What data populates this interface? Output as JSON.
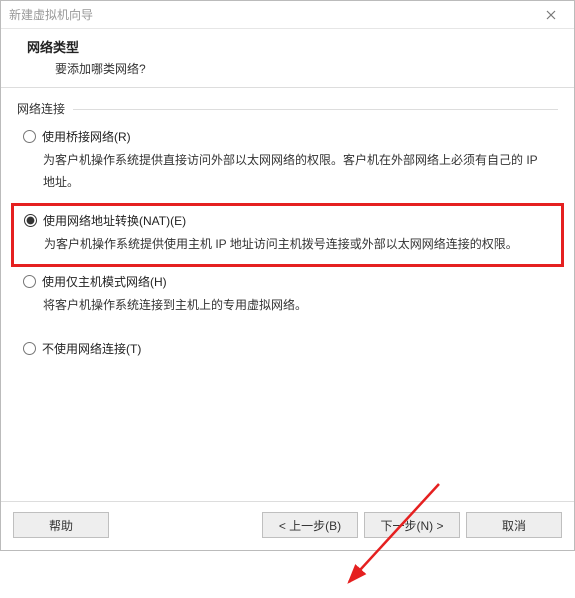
{
  "window": {
    "title": "新建虚拟机向导"
  },
  "header": {
    "title": "网络类型",
    "subtitle": "要添加哪类网络?"
  },
  "group": {
    "label": "网络连接"
  },
  "options": {
    "bridged": {
      "label": "使用桥接网络(R)",
      "desc": "为客户机操作系统提供直接访问外部以太网网络的权限。客户机在外部网络上必须有自己的 IP 地址。"
    },
    "nat": {
      "label": "使用网络地址转换(NAT)(E)",
      "desc": "为客户机操作系统提供使用主机 IP 地址访问主机拨号连接或外部以太网网络连接的权限。"
    },
    "hostonly": {
      "label": "使用仅主机模式网络(H)",
      "desc": "将客户机操作系统连接到主机上的专用虚拟网络。"
    },
    "none": {
      "label": "不使用网络连接(T)"
    }
  },
  "buttons": {
    "help": "帮助",
    "back": "< 上一步(B)",
    "next": "下一步(N) >",
    "cancel": "取消"
  },
  "colors": {
    "highlight": "#e52020"
  }
}
